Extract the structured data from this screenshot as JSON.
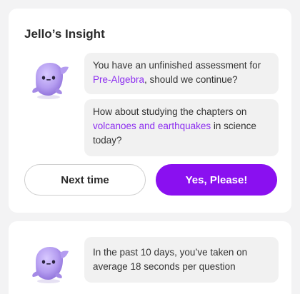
{
  "insight_card": {
    "title": "Jello’s Insight",
    "message_1": {
      "before": "You have an unfinished assessment for ",
      "link": "Pre-Algebra",
      "after": ", should we continue?"
    },
    "message_2": {
      "before": "How about studying the chapters on ",
      "link": "volcanoes and earthquakes",
      "after": " in science today?"
    },
    "secondary_button": "Next time",
    "primary_button": "Yes, Please!"
  },
  "stats_card": {
    "message": " In the past 10 days, you’ve taken on average 18 seconds per question"
  },
  "colors": {
    "accent": "#8a10f0",
    "link": "#8c2df0",
    "mascot": "#b49cf0"
  },
  "icons": {
    "mascot": "jello-mascot-icon"
  }
}
